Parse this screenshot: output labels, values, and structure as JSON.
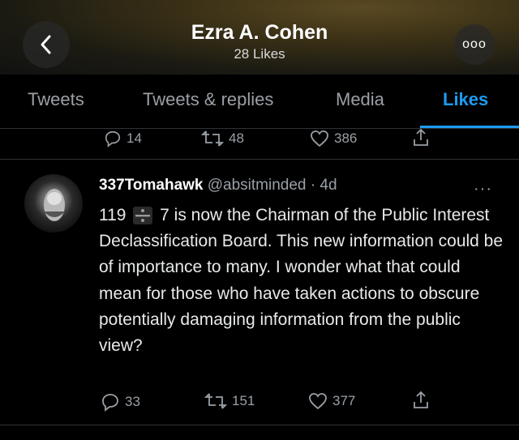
{
  "header": {
    "title": "Ezra A. Cohen",
    "subtitle": "28 Likes",
    "back_icon": "chevron-left-icon",
    "more_icon": "more-horizontal-icon",
    "more_glyph": "ooo",
    "gradient_color": "#5a4a22"
  },
  "tabs": [
    {
      "label": "Tweets",
      "active": false
    },
    {
      "label": "Tweets & replies",
      "active": false
    },
    {
      "label": "Media",
      "active": false
    },
    {
      "label": "Likes",
      "active": true
    }
  ],
  "accent_color": "#1d9bf0",
  "previous_tweet": {
    "replies": "14",
    "retweets": "48",
    "likes": "386"
  },
  "tweet": {
    "name": "337Tomahawk",
    "meta": "@absitminded · 4d",
    "text_before_icon": "119",
    "text_after_icon": "7 is now the Chairman of the Public Interest Declassification Board. This new information could be of importance to many. I wonder what that could mean for those who have taken actions to obscure potentially damaging information from the public view?",
    "replies": "33",
    "retweets": "151",
    "likes": "377",
    "more_glyph": "···"
  }
}
